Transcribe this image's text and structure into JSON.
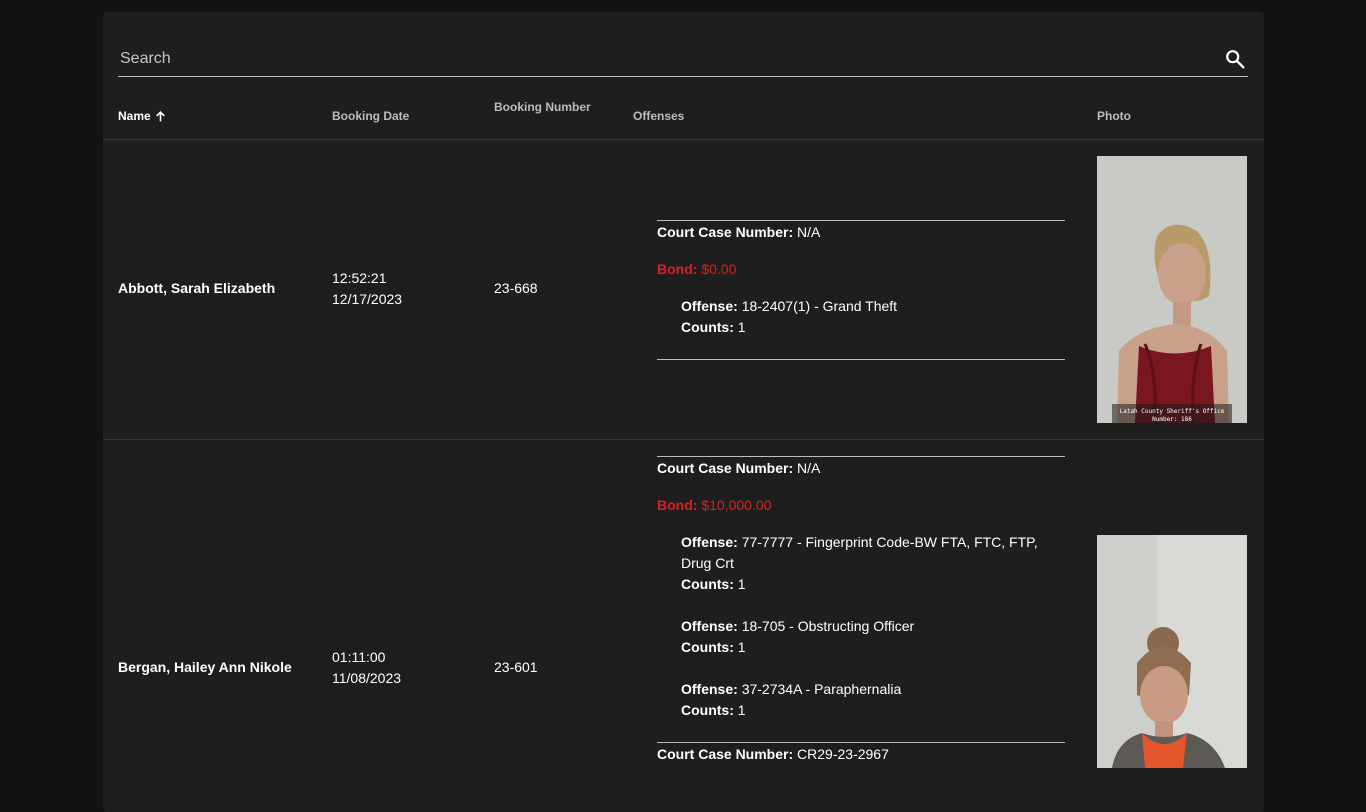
{
  "search": {
    "placeholder": "Search"
  },
  "columns": {
    "name": "Name",
    "booking_date": "Booking Date",
    "booking_number": "Booking Number",
    "offenses": "Offenses",
    "photo": "Photo"
  },
  "sort": {
    "column": "name",
    "direction": "ascending",
    "icon": "arrow-up-icon"
  },
  "labels": {
    "court_case": "Court Case Number:",
    "bond": "Bond:",
    "offense": "Offense:",
    "counts": "Counts:"
  },
  "rows": [
    {
      "name": "Abbott, Sarah Elizabeth",
      "booking_time": "12:52:21",
      "booking_date": "12/17/2023",
      "booking_number": "23-668",
      "cases": [
        {
          "court_case_number": "N/A",
          "bond": "$0.00",
          "offenses": [
            {
              "offense": "18-2407(1) - Grand Theft",
              "counts": "1"
            }
          ]
        }
      ],
      "photo_caption_line1": "Latah County Sheriff's Office",
      "photo_caption_line2": "Number: 186"
    },
    {
      "name": "Bergan, Hailey Ann Nikole",
      "booking_time": "01:11:00",
      "booking_date": "11/08/2023",
      "booking_number": "23-601",
      "cases": [
        {
          "court_case_number": "N/A",
          "bond": "$10,000.00",
          "offenses": [
            {
              "offense": "77-7777 - Fingerprint Code-BW FTA, FTC, FTP, Drug Crt",
              "counts": "1"
            },
            {
              "offense": "18-705 - Obstructing Officer",
              "counts": "1"
            },
            {
              "offense": "37-2734A - Paraphernalia",
              "counts": "1"
            }
          ]
        },
        {
          "court_case_number": "CR29-23-2967"
        }
      ]
    }
  ],
  "colors": {
    "background": "#121212",
    "panel": "#1e1e1e",
    "bond_red": "#e01e1e"
  }
}
